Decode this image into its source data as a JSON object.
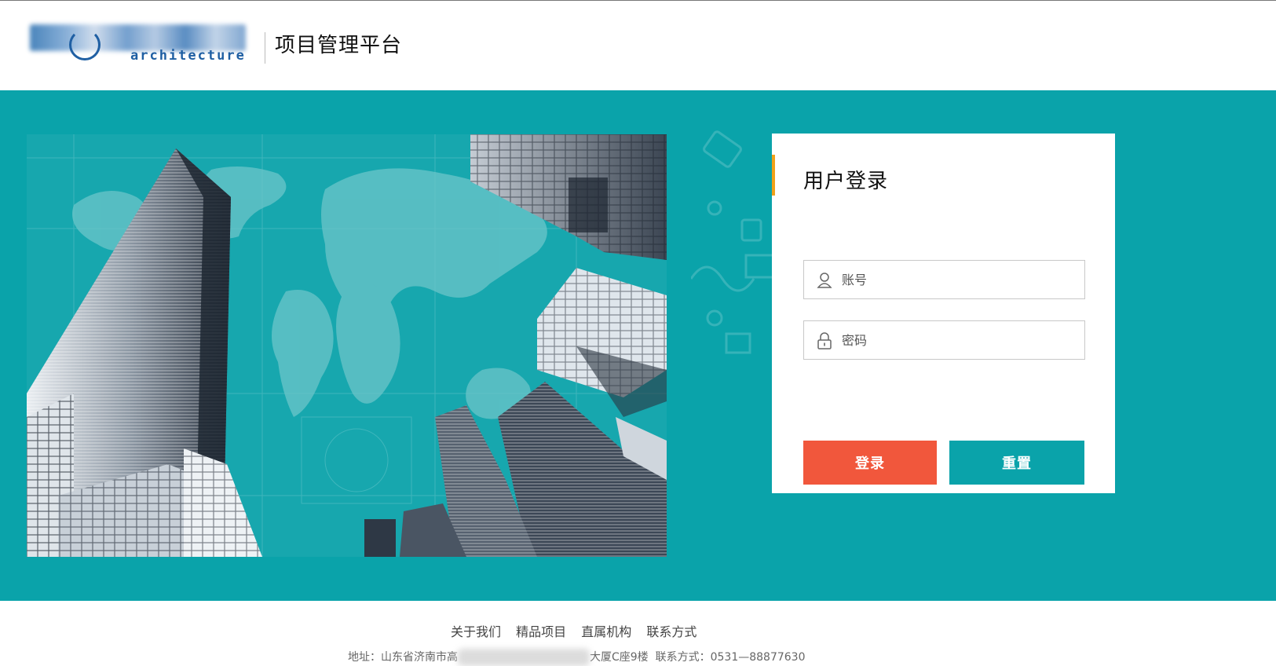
{
  "header": {
    "logo_text": "architecture",
    "title": "项目管理平台"
  },
  "login": {
    "title": "用户登录",
    "username_placeholder": "账号",
    "password_placeholder": "密码",
    "login_label": "登录",
    "reset_label": "重置"
  },
  "footer": {
    "links": [
      "关于我们",
      "精品项目",
      "直属机构",
      "联系方式"
    ],
    "address_prefix": "地址：山东省济南市高",
    "address_suffix": "大厦C座9楼",
    "contact": "联系方式：0531—88877630"
  },
  "colors": {
    "teal": "#0aa3aa",
    "login_button": "#f1573c",
    "accent": "#f0a11a"
  },
  "icons": {
    "username": "user-icon",
    "password": "lock-icon"
  }
}
